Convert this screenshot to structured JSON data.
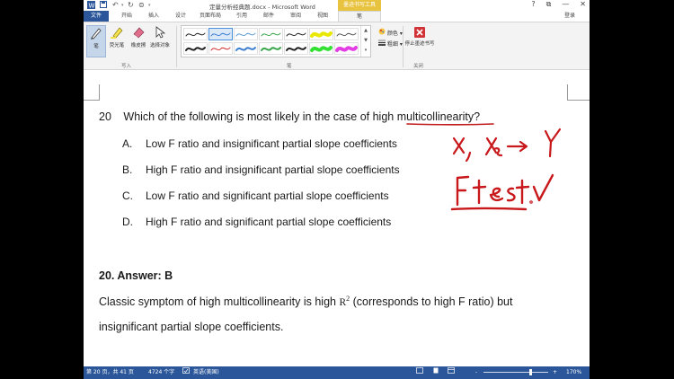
{
  "titlebar": {
    "title": "定量分析经典题.docx - Microsoft Word",
    "context_tab": "墨迹书写工具",
    "help": "?",
    "restore": "⧉",
    "minimize": "—",
    "close": "✕"
  },
  "tabs": {
    "file": "文件",
    "items": [
      "开始",
      "插入",
      "设计",
      "页面布局",
      "引用",
      "邮件",
      "审阅",
      "视图"
    ],
    "pen": "笔",
    "login": "登录"
  },
  "ribbon": {
    "write_group": {
      "pen": "笔",
      "highlighter": "荧光笔",
      "eraser": "橡皮擦",
      "select": "选择对象",
      "label": "写入"
    },
    "pens_group_label": "笔",
    "pen_styles": [
      {
        "color": "#222222",
        "w": 1
      },
      {
        "color": "#3c7fd1",
        "w": 1
      },
      {
        "color": "#5b9bd5",
        "w": 1
      },
      {
        "color": "#3aa64a",
        "w": 1
      },
      {
        "color": "#222222",
        "w": 1
      },
      {
        "color": "#e8e800",
        "w": 4
      },
      {
        "color": "#555555",
        "w": 1
      },
      {
        "color": "#222222",
        "w": 2
      },
      {
        "color": "#d12d2d",
        "w": 1
      },
      {
        "color": "#3c7fd1",
        "w": 2
      },
      {
        "color": "#3aa64a",
        "w": 2
      },
      {
        "color": "#222222",
        "w": 2
      },
      {
        "color": "#35e035",
        "w": 4
      },
      {
        "color": "#e33ee3",
        "w": 4
      }
    ],
    "color_label": "颜色",
    "thickness_label": "粗细",
    "stop_label": "停止墨迹书写",
    "close_group_label": "关闭"
  },
  "document": {
    "question_number": "20",
    "question": "Which of the following is most likely in the case of high multicollinearity?",
    "options": [
      {
        "letter": "A.",
        "text": "Low F ratio and insignificant partial slope coefficients"
      },
      {
        "letter": "B.",
        "text": "High F ratio and insignificant partial slope coefficients"
      },
      {
        "letter": "C.",
        "text": "Low F ratio and significant partial slope coefficients"
      },
      {
        "letter": "D.",
        "text": "High F ratio and significant partial slope coefficients"
      }
    ],
    "answer": "20.   Answer: B",
    "explanation_part1": "Classic symptom of high multicollinearity is high ",
    "r_squared": "R",
    "r_squared_sup": "2",
    "explanation_part2": "  (corresponds to high F ratio) but",
    "explanation_line2": "insignificant partial slope coefficients.",
    "ink_note_1": "x₁, x₂ → Y",
    "ink_note_2": "F test ✓"
  },
  "statusbar": {
    "page": "第 20 页，共 41 页",
    "words": "4724 个字",
    "language": "英语(美国)",
    "zoom_minus": "-",
    "zoom_plus": "+",
    "zoom": "170%",
    "zoom_level": 0.72
  }
}
